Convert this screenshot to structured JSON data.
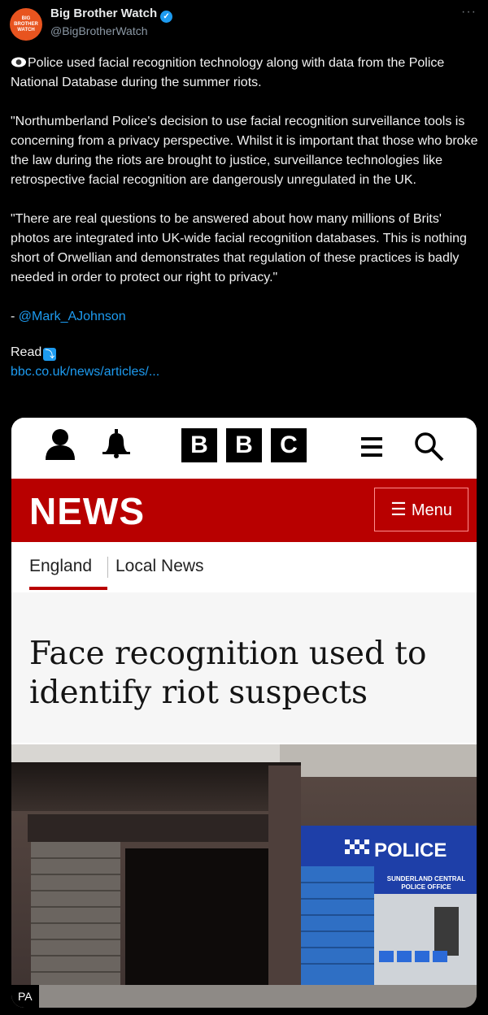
{
  "account": {
    "name": "Big Brother Watch",
    "handle": "@BigBrotherWatch",
    "avatar_text": [
      "BIG",
      "BROTHER",
      "WATCH"
    ],
    "verified": true
  },
  "tweet": {
    "intro": "Police used facial recognition technology along with data from the Police National Database during the summer riots.",
    "quote1": "\"Northumberland Police's decision to use facial recognition surveillance tools is concerning from a privacy perspective. Whilst it is important that those who broke the law during the riots are brought to justice, surveillance technologies like retrospective facial recognition are dangerously unregulated in the UK.",
    "quote2": "\"There are real questions to be answered about how many millions of Brits' photos are integrated into UK-wide facial recognition databases. This is nothing short of Orwellian and demonstrates that regulation of these practices is badly needed in order to protect our right to privacy.\"",
    "attribution_prefix": "- ",
    "attribution_handle": "@Mark_AJohnson",
    "read_label": "Read",
    "url": "bbc.co.uk/news/articles/..."
  },
  "bbc": {
    "logo_letters": [
      "B",
      "B",
      "C"
    ],
    "news_label": "NEWS",
    "menu_label": "Menu",
    "subnav": [
      "England",
      "Local News"
    ],
    "headline": "Face recognition used to identify riot suspects",
    "photo_credit": "PA",
    "police_sign": "POLICE",
    "police_office": [
      "SUNDERLAND CENTRAL",
      "POLICE OFFICE"
    ]
  },
  "colors": {
    "bbc_red": "#b80000",
    "link_blue": "#1d9bf0",
    "police_blue": "#1e3fa8"
  }
}
